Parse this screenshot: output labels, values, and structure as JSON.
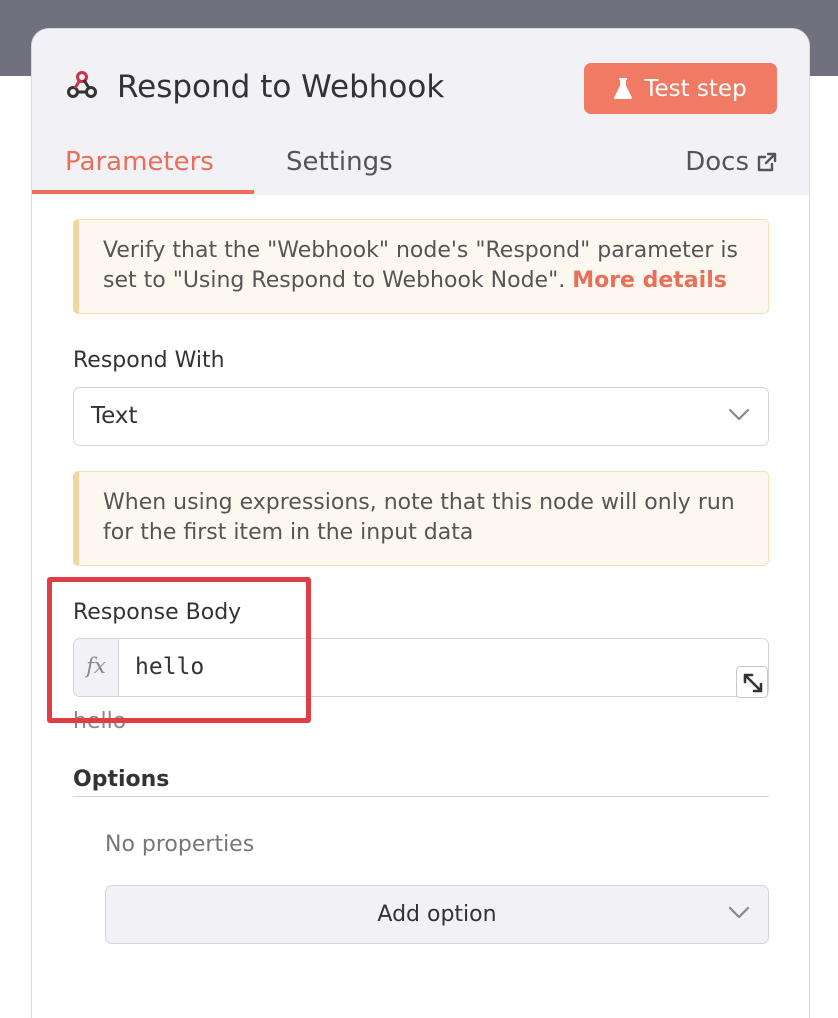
{
  "header": {
    "node_title": "Respond to Webhook",
    "node_icon": "webhook-icon",
    "test_button_label": "Test step",
    "test_button_icon": "flask-icon",
    "accent_color": "#ea6f5a"
  },
  "tabs": {
    "parameters": "Parameters",
    "settings": "Settings",
    "docs": "Docs",
    "active": "Parameters"
  },
  "notices": {
    "webhook_text": "Verify that the \"Webhook\" node's \"Respond\" parameter is set to \"Using Respond to Webhook Node\". ",
    "webhook_link": "More details",
    "expression_text": "When using expressions, note that this node will only run for the first item in the input data"
  },
  "fields": {
    "respond_with_label": "Respond With",
    "respond_with_value": "Text",
    "response_body_label": "Response Body",
    "fx_label": "fx",
    "response_body_value": "hello",
    "response_body_preview": "hello"
  },
  "options": {
    "title": "Options",
    "empty_text": "No properties",
    "add_button_label": "Add option"
  }
}
